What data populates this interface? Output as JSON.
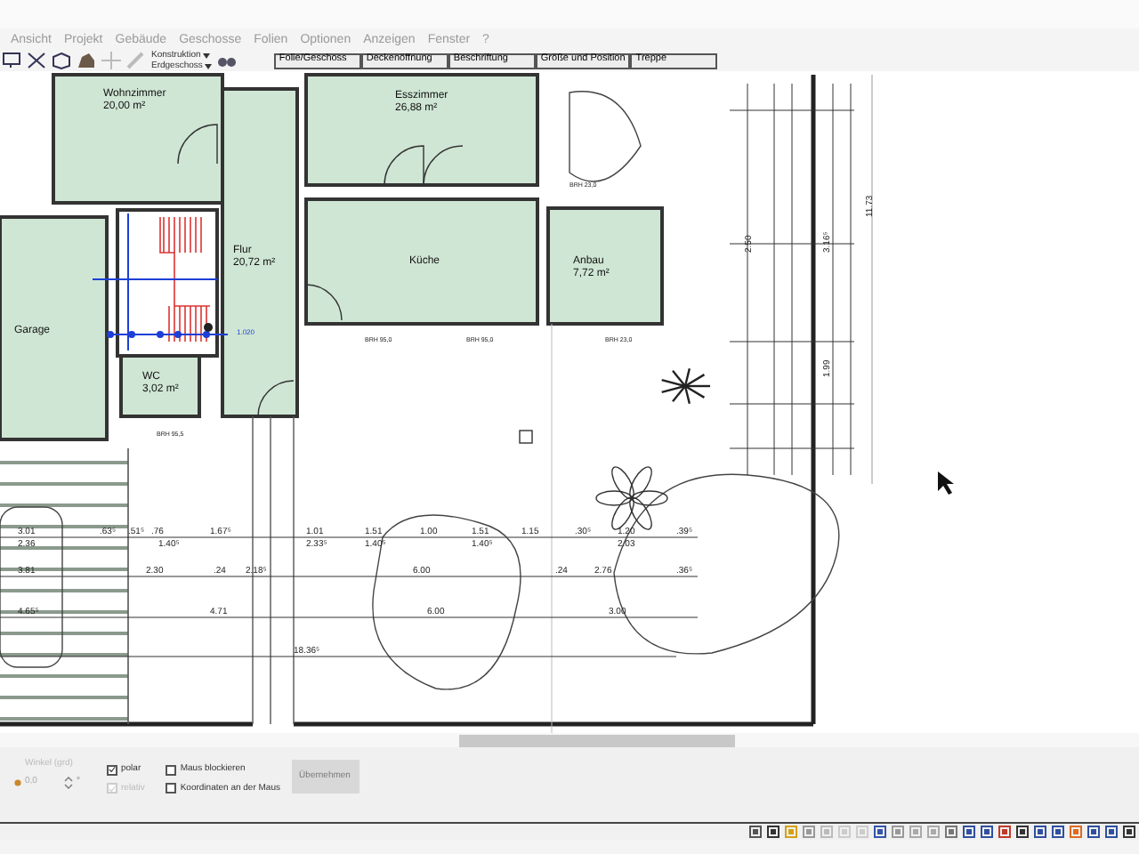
{
  "menu": [
    "Ansicht",
    "Projekt",
    "Gebäude",
    "Geschosse",
    "Folien",
    "Optionen",
    "Anzeigen",
    "Fenster",
    "?"
  ],
  "toolbar": {
    "dropdowns": [
      "Konstruktion",
      "Erdgeschoss"
    ],
    "tabs": [
      {
        "label": "Folie/Geschoss",
        "selected": false
      },
      {
        "label": "Deckenöffnung",
        "selected": false
      },
      {
        "label": "Beschriftung",
        "selected": false
      },
      {
        "label": "Größe und Position",
        "selected": false
      },
      {
        "label": "Treppe",
        "selected": false
      }
    ]
  },
  "plan": {
    "rooms": [
      {
        "name": "Wohnzimmer",
        "area": "20,00 m²"
      },
      {
        "name": "Esszimmer",
        "area": "26,88 m²"
      },
      {
        "name": "Flur",
        "area": "20,72 m²"
      },
      {
        "name": "Küche"
      },
      {
        "name": "Anbau",
        "area": "7,72 m²"
      },
      {
        "name": "Garage"
      },
      {
        "name": "WC",
        "area": "3,02 m²"
      }
    ],
    "window_labels": [
      "BRH 23,0",
      "BRH 95,0",
      "BRH 95,0",
      "BRH 23,0",
      "BRH 95,5"
    ],
    "stair_dimension": "1.020",
    "dimension_rows": [
      [
        "3.01",
        "2.36",
        ".63⁵",
        ".51⁵",
        ".76",
        "1.40⁵",
        "1.67⁵",
        "1.01",
        "2.33⁵",
        "1.51",
        "1.40⁵",
        "1.00",
        "1.51",
        "1.40⁵",
        "1.15",
        ".30⁵",
        "1.20",
        "2.03",
        ".39⁵"
      ],
      [
        "3.81",
        "2.30",
        ".24",
        "2.18⁵",
        "6.00",
        ".24",
        "2.76",
        ".36⁵"
      ],
      [
        "4.65⁵",
        "4.71",
        "6.00",
        "3.00"
      ],
      [
        "18.36⁵"
      ]
    ],
    "vertical_dimensions": [
      "2.50",
      "3.16⁵",
      "1.99",
      "11.73"
    ]
  },
  "angle": {
    "label": "Winkel (grd)",
    "value": "0,0",
    "unit": "°",
    "disabled": true
  },
  "options": [
    {
      "label": "polar",
      "checked": true,
      "disabled": false
    },
    {
      "label": "relativ",
      "checked": true,
      "disabled": true
    },
    {
      "label": "Maus blockieren",
      "checked": false,
      "disabled": false
    },
    {
      "label": "Koordinaten an der Maus",
      "checked": false,
      "disabled": false
    }
  ],
  "apply_button": {
    "label": "Übernehmen",
    "disabled": true
  }
}
